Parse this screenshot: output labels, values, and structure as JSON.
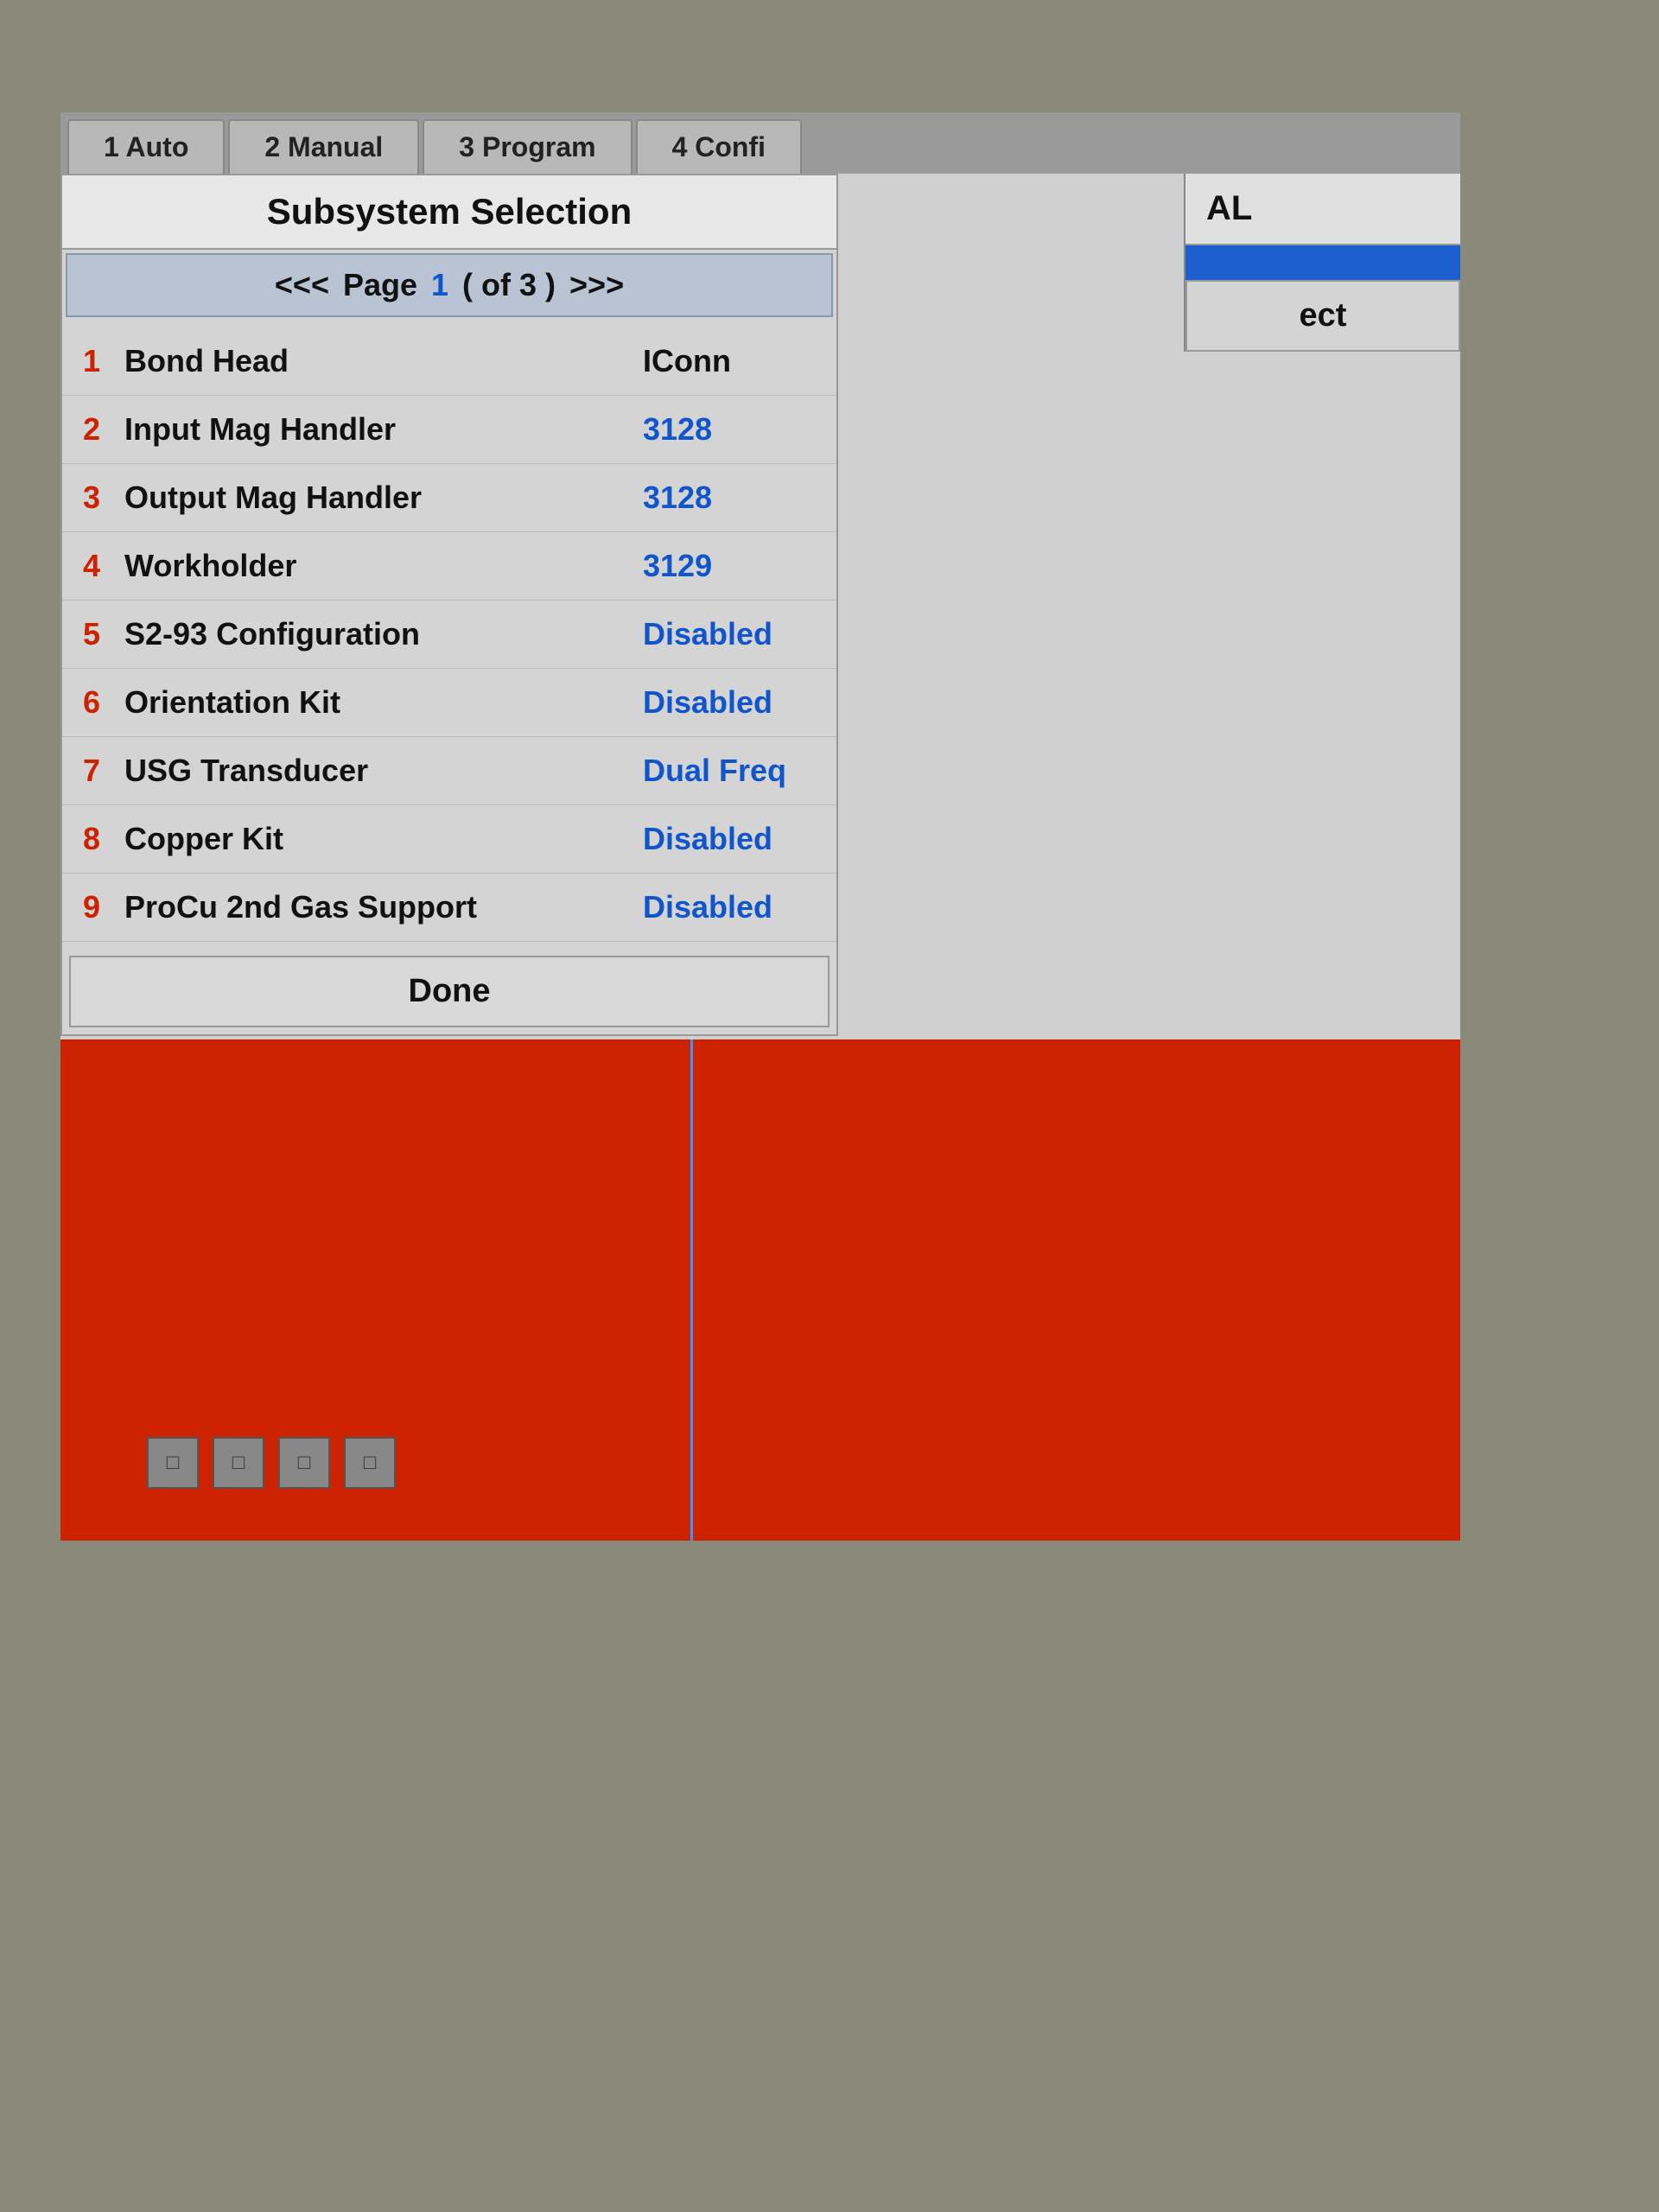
{
  "tabs": [
    {
      "id": "auto",
      "label": "1 Auto"
    },
    {
      "id": "manual",
      "label": "2 Manual"
    },
    {
      "id": "program",
      "label": "3 Program"
    },
    {
      "id": "config",
      "label": "4 Confi"
    }
  ],
  "panel": {
    "title": "Subsystem Selection",
    "pagination": {
      "prev": "<<<",
      "label": "Page",
      "current": "1",
      "total": "( of 3 )",
      "next": ">>>"
    },
    "items": [
      {
        "number": "1",
        "name": "Bond Head",
        "value": "IConn",
        "valueClass": "black"
      },
      {
        "number": "2",
        "name": "Input Mag Handler",
        "value": "3128",
        "valueClass": ""
      },
      {
        "number": "3",
        "name": "Output Mag Handler",
        "value": "3128",
        "valueClass": ""
      },
      {
        "number": "4",
        "name": "Workholder",
        "value": "3129",
        "valueClass": ""
      },
      {
        "number": "5",
        "name": "S2-93 Configuration",
        "value": "Disabled",
        "valueClass": ""
      },
      {
        "number": "6",
        "name": "Orientation Kit",
        "value": "Disabled",
        "valueClass": ""
      },
      {
        "number": "7",
        "name": "USG Transducer",
        "value": "Dual Freq",
        "valueClass": ""
      },
      {
        "number": "8",
        "name": "Copper Kit",
        "value": "Disabled",
        "valueClass": ""
      },
      {
        "number": "9",
        "name": "ProCu 2nd Gas Support",
        "value": "Disabled",
        "valueClass": ""
      }
    ],
    "done_button": "Done"
  },
  "right_panel": {
    "al_label": "AL",
    "blue_label": "",
    "select_label": "ect"
  }
}
